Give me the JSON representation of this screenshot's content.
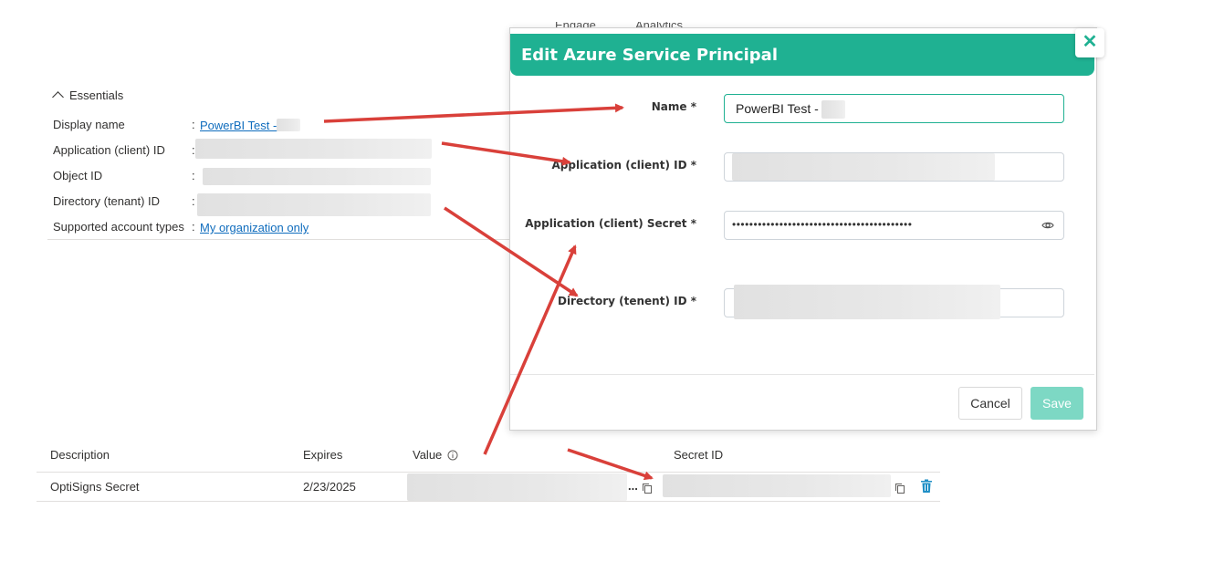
{
  "background_nav": {
    "items": [
      "Engage",
      "Analytics"
    ]
  },
  "essentials": {
    "title": "Essentials",
    "rows": [
      {
        "label": "Display name",
        "value": "PowerBI Test -"
      },
      {
        "label": "Application (client) ID",
        "value": ""
      },
      {
        "label": "Object ID",
        "value": ""
      },
      {
        "label": "Directory (tenant) ID",
        "value": ""
      },
      {
        "label": "Supported account types",
        "value": "My organization only"
      }
    ]
  },
  "modal": {
    "title": "Edit Azure Service Principal",
    "fields": {
      "name": {
        "label": "Name *",
        "value": "PowerBI Test -"
      },
      "client_id": {
        "label": "Application (client) ID *",
        "value": ""
      },
      "client_secret": {
        "label": "Application (client) Secret *",
        "value": "••••••••••••••••••••••••••••••••••••••••••"
      },
      "tenant_id": {
        "label": "Directory (tenent) ID *",
        "value": ""
      }
    },
    "cancel_label": "Cancel",
    "save_label": "Save",
    "close_glyph": "✕"
  },
  "secrets_table": {
    "headers": {
      "description": "Description",
      "expires": "Expires",
      "value": "Value",
      "secret_id": "Secret ID"
    },
    "rows": [
      {
        "description": "OptiSigns Secret",
        "expires": "2/23/2025",
        "value_ellipsis": "..."
      }
    ]
  },
  "colors": {
    "accent": "#1fb192",
    "link": "#0f6cbd",
    "arrow": "#d9403a",
    "save_disabled": "#7dd8c4"
  },
  "icons": [
    "chevron-up-icon",
    "close-icon",
    "eye-icon",
    "info-icon",
    "copy-icon",
    "trash-icon"
  ]
}
